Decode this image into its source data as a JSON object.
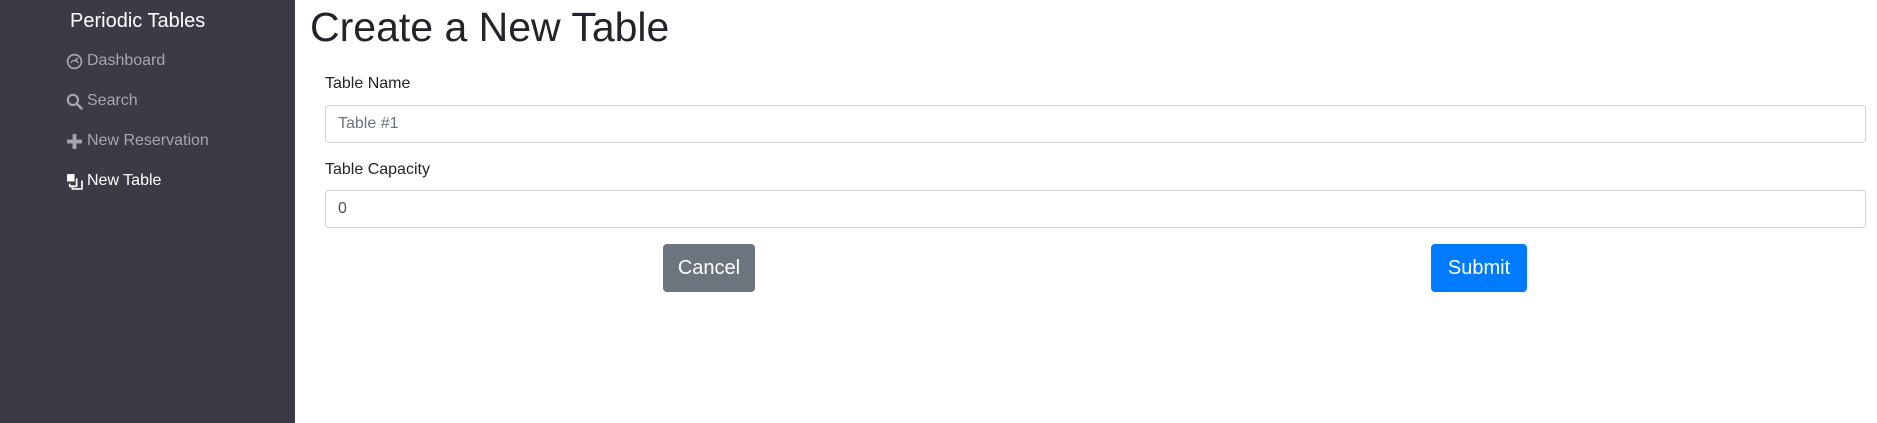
{
  "sidebar": {
    "brand": "Periodic Tables",
    "items": [
      {
        "label": "Dashboard",
        "icon": "dashboard-icon",
        "active": false
      },
      {
        "label": "Search",
        "icon": "search-icon",
        "active": false
      },
      {
        "label": "New Reservation",
        "icon": "plus-icon",
        "active": false
      },
      {
        "label": "New Table",
        "icon": "layers-icon",
        "active": true
      }
    ]
  },
  "main": {
    "title": "Create a New Table",
    "form": {
      "table_name": {
        "label": "Table Name",
        "placeholder": "Table #1",
        "value": ""
      },
      "table_capacity": {
        "label": "Table Capacity",
        "value": "0"
      }
    },
    "buttons": {
      "cancel_label": "Cancel",
      "submit_label": "Submit"
    }
  },
  "colors": {
    "sidebar_bg": "#3a3b45",
    "nav_text": "#a5a7ad",
    "nav_active": "#ffffff",
    "cancel_bg": "#6c757d",
    "submit_bg": "#007bff"
  }
}
